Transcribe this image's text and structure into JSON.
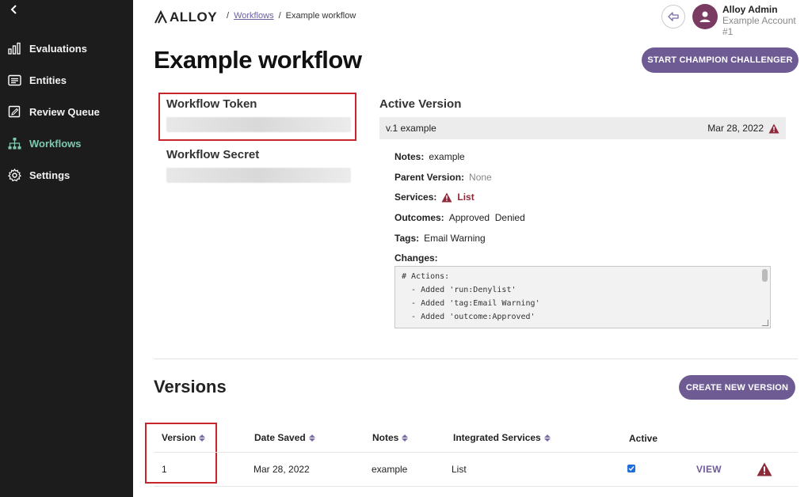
{
  "sidebar": {
    "items": [
      {
        "label": "Evaluations",
        "icon": "bar-chart-icon"
      },
      {
        "label": "Entities",
        "icon": "list-card-icon"
      },
      {
        "label": "Review Queue",
        "icon": "edit-square-icon"
      },
      {
        "label": "Workflows",
        "icon": "hierarchy-icon",
        "active": true
      },
      {
        "label": "Settings",
        "icon": "gear-icon"
      }
    ]
  },
  "header": {
    "logo": "ALLOY",
    "breadcrumb": {
      "parent": "Workflows",
      "current": "Example workflow"
    },
    "user": {
      "name": "Alloy Admin",
      "account": "Example Account #1"
    }
  },
  "page": {
    "title": "Example workflow",
    "champion_button": "START CHAMPION CHALLENGER"
  },
  "credentials": {
    "token_label": "Workflow Token",
    "secret_label": "Workflow Secret"
  },
  "active_version": {
    "label": "Active Version",
    "name": "v.1 example",
    "date": "Mar 28, 2022",
    "notes_key": "Notes:",
    "notes": "example",
    "parent_key": "Parent Version:",
    "parent": "None",
    "services_key": "Services:",
    "services": "List",
    "outcomes_key": "Outcomes:",
    "outcomes": "Approved  Denied",
    "tags_key": "Tags:",
    "tags": "Email Warning",
    "changes_key": "Changes:",
    "changes": [
      "# Actions:",
      "  - Added 'run:Denylist'",
      "  - Added 'tag:Email Warning'",
      "  - Added 'outcome:Approved'"
    ]
  },
  "versions": {
    "title": "Versions",
    "create_button": "CREATE NEW VERSION",
    "columns": [
      "Version",
      "Date Saved",
      "Notes",
      "Integrated Services",
      "Active"
    ],
    "rows": [
      {
        "version": "1",
        "date_saved": "Mar 28, 2022",
        "notes": "example",
        "services": "List",
        "active": true,
        "action": "VIEW"
      }
    ]
  },
  "colors": {
    "sidebar_bg": "#1c1c1c",
    "active_nav": "#7ec8b0",
    "accent": "#6e5b94",
    "warning": "#8c2a3a",
    "highlight_box": "#c8242b"
  }
}
